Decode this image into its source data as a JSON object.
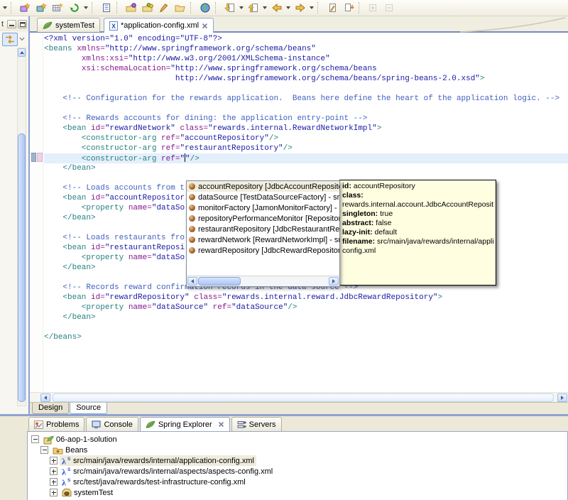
{
  "window": {
    "background": "#ece9d8"
  },
  "toolbar": {
    "items": [
      {
        "type": "caret",
        "name": "overflow-caret"
      },
      {
        "type": "sep"
      },
      {
        "type": "icon",
        "name": "new-spring-project"
      },
      {
        "type": "icon",
        "name": "new-wizard"
      },
      {
        "type": "icon",
        "name": "new-table"
      },
      {
        "type": "icon",
        "name": "refresh"
      },
      {
        "type": "caret",
        "name": "refresh-caret"
      },
      {
        "type": "sep"
      },
      {
        "type": "icon",
        "name": "open-editor"
      },
      {
        "type": "sep"
      },
      {
        "type": "icon",
        "name": "debug"
      },
      {
        "type": "icon",
        "name": "run"
      },
      {
        "type": "icon",
        "name": "external-tools"
      },
      {
        "type": "icon",
        "name": "open-folder"
      },
      {
        "type": "sep"
      },
      {
        "type": "icon",
        "name": "open-web-browser"
      },
      {
        "type": "sep"
      },
      {
        "type": "icon",
        "name": "import"
      },
      {
        "type": "caret",
        "name": "import-caret"
      },
      {
        "type": "icon",
        "name": "export"
      },
      {
        "type": "caret",
        "name": "export-caret"
      },
      {
        "type": "icon",
        "name": "back"
      },
      {
        "type": "caret",
        "name": "back-caret"
      },
      {
        "type": "icon",
        "name": "forward"
      },
      {
        "type": "caret",
        "name": "forward-caret"
      },
      {
        "type": "sep"
      },
      {
        "type": "icon",
        "name": "last-edit-location"
      },
      {
        "type": "icon",
        "name": "next-annotation"
      },
      {
        "type": "sep"
      },
      {
        "type": "icon",
        "name": "expand-all",
        "disabled": true
      },
      {
        "type": "icon",
        "name": "collapse-all",
        "disabled": true
      }
    ]
  },
  "left_panel": {
    "title_fragment": "t"
  },
  "editor": {
    "tabs": [
      {
        "label": "systemTest",
        "icon": "spring-leaf",
        "active": false,
        "closable": false
      },
      {
        "label": "*application-config.xml",
        "icon": "xml-file",
        "active": true,
        "closable": true
      }
    ],
    "page_tabs": [
      {
        "label": "Design",
        "active": false
      },
      {
        "label": "Source",
        "active": true
      }
    ],
    "current_line": 13,
    "code_lines": [
      [
        {
          "c": "pi",
          "t": "<?xml version=\"1.0\" encoding=\"UTF-8\"?>"
        }
      ],
      [
        {
          "c": "tag",
          "t": "<beans "
        },
        {
          "c": "attr",
          "t": "xmlns="
        },
        {
          "c": "val",
          "t": "\"http://www.springframework.org/schema/beans\""
        }
      ],
      [
        {
          "c": "txt",
          "t": "        "
        },
        {
          "c": "attr",
          "t": "xmlns:xsi="
        },
        {
          "c": "val",
          "t": "\"http://www.w3.org/2001/XMLSchema-instance\""
        }
      ],
      [
        {
          "c": "txt",
          "t": "        "
        },
        {
          "c": "attr",
          "t": "xsi:schemaLocation="
        },
        {
          "c": "val",
          "t": "\"http://www.springframework.org/schema/beans"
        }
      ],
      [
        {
          "c": "val",
          "t": "                            http://www.springframework.org/schema/beans/spring-beans-2.0.xsd\""
        },
        {
          "c": "tag",
          "t": ">"
        }
      ],
      [],
      [
        {
          "c": "com",
          "t": "    <!-- Configuration for the rewards application.  Beans here define the heart of the application logic. -->"
        }
      ],
      [],
      [
        {
          "c": "com",
          "t": "    <!-- Rewards accounts for dining: the application entry-point -->"
        }
      ],
      [
        {
          "c": "tag",
          "t": "    <bean "
        },
        {
          "c": "attr",
          "t": "id="
        },
        {
          "c": "val",
          "t": "\"rewardNetwork\""
        },
        {
          "c": "txt",
          "t": " "
        },
        {
          "c": "attr",
          "t": "class="
        },
        {
          "c": "val",
          "t": "\"rewards.internal.RewardNetworkImpl\""
        },
        {
          "c": "tag",
          "t": ">"
        }
      ],
      [
        {
          "c": "tag",
          "t": "        <constructor-arg "
        },
        {
          "c": "attr",
          "t": "ref="
        },
        {
          "c": "val",
          "t": "\"accountRepository\""
        },
        {
          "c": "tag",
          "t": "/>"
        }
      ],
      [
        {
          "c": "tag",
          "t": "        <constructor-arg "
        },
        {
          "c": "attr",
          "t": "ref="
        },
        {
          "c": "val",
          "t": "\"restaurantRepository\""
        },
        {
          "c": "tag",
          "t": "/>"
        }
      ],
      [
        {
          "c": "tag",
          "t": "        <constructor-arg "
        },
        {
          "c": "attr",
          "t": "ref="
        },
        {
          "c": "val",
          "t": "\""
        },
        {
          "c": "caret"
        },
        {
          "c": "val",
          "t": "\""
        },
        {
          "c": "tag",
          "t": "/>"
        }
      ],
      [
        {
          "c": "tag",
          "t": "    </bean>"
        }
      ],
      [],
      [
        {
          "c": "com",
          "t": "    <!-- Loads accounts from t"
        }
      ],
      [
        {
          "c": "tag",
          "t": "    <bean "
        },
        {
          "c": "attr",
          "t": "id="
        },
        {
          "c": "val",
          "t": "\"accountRepositor"
        }
      ],
      [
        {
          "c": "tag",
          "t": "        <property "
        },
        {
          "c": "attr",
          "t": "name="
        },
        {
          "c": "val",
          "t": "\"dataSo"
        }
      ],
      [
        {
          "c": "tag",
          "t": "    </bean>"
        }
      ],
      [],
      [
        {
          "c": "com",
          "t": "    <!-- Loads restaurants fro"
        }
      ],
      [
        {
          "c": "tag",
          "t": "    <bean "
        },
        {
          "c": "attr",
          "t": "id="
        },
        {
          "c": "val",
          "t": "\"restaurantReposi"
        }
      ],
      [
        {
          "c": "tag",
          "t": "        <property "
        },
        {
          "c": "attr",
          "t": "name="
        },
        {
          "c": "val",
          "t": "\"dataSo"
        }
      ],
      [
        {
          "c": "tag",
          "t": "    </bean>"
        }
      ],
      [],
      [
        {
          "c": "com",
          "t": "    <!-- Records reward confirmation records in the data source -->"
        }
      ],
      [
        {
          "c": "tag",
          "t": "    <bean "
        },
        {
          "c": "attr",
          "t": "id="
        },
        {
          "c": "val",
          "t": "\"rewardRepository\""
        },
        {
          "c": "txt",
          "t": " "
        },
        {
          "c": "attr",
          "t": "class="
        },
        {
          "c": "val",
          "t": "\"rewards.internal.reward.JdbcRewardRepository\""
        },
        {
          "c": "tag",
          "t": ">"
        }
      ],
      [
        {
          "c": "tag",
          "t": "        <property "
        },
        {
          "c": "attr",
          "t": "name="
        },
        {
          "c": "val",
          "t": "\"dataSource\""
        },
        {
          "c": "txt",
          "t": " "
        },
        {
          "c": "attr",
          "t": "ref="
        },
        {
          "c": "val",
          "t": "\"dataSource\""
        },
        {
          "c": "tag",
          "t": "/>"
        }
      ],
      [
        {
          "c": "tag",
          "t": "    </bean>"
        }
      ],
      [],
      [
        {
          "c": "tag",
          "t": "</beans>"
        }
      ]
    ]
  },
  "completion_popup": {
    "selected_index": 0,
    "items": [
      {
        "icon": "bean",
        "label": "accountRepository [JdbcAccountRepository] - src/main/ja"
      },
      {
        "icon": "bean",
        "label": "dataSource [TestDataSourceFactory] - src/test/ja"
      },
      {
        "icon": "bean",
        "label": "monitorFactory [JamonMonitorFactory] - src/main"
      },
      {
        "icon": "bean",
        "label": "repositoryPerformanceMonitor [RepositoryPerform"
      },
      {
        "icon": "bean",
        "label": "restaurantRepository [JdbcRestaurantRepository"
      },
      {
        "icon": "bean",
        "label": "rewardNetwork [RewardNetworkImpl] - src/main/j"
      },
      {
        "icon": "bean",
        "label": "rewardRepository [JdbcRewardRepository] - src/r"
      }
    ]
  },
  "bean_tooltip": {
    "lines": [
      [
        {
          "b": "id:"
        },
        {
          "t": " accountRepository"
        }
      ],
      [
        {
          "b": "class:"
        }
      ],
      [
        {
          "t": " rewards.internal.account.JdbcAccountRepository"
        }
      ],
      [
        {
          "b": "singleton:"
        },
        {
          "t": " true"
        }
      ],
      [
        {
          "b": "abstract:"
        },
        {
          "t": " false"
        }
      ],
      [
        {
          "b": "lazy-init:"
        },
        {
          "t": " default"
        }
      ],
      [
        {
          "b": "filename:"
        },
        {
          "t": " src/main/java/rewards/internal/application-"
        }
      ],
      [
        {
          "t": " config.xml"
        }
      ]
    ]
  },
  "bottom_panel": {
    "tabs": [
      {
        "label": "Problems",
        "icon": "problems",
        "active": false,
        "closable": false
      },
      {
        "label": "Console",
        "icon": "console",
        "active": false,
        "closable": false
      },
      {
        "label": "Spring Explorer",
        "icon": "spring-leaf",
        "active": true,
        "closable": true
      },
      {
        "label": "Servers",
        "icon": "servers",
        "active": false,
        "closable": false
      }
    ],
    "tree": [
      {
        "label": "06-aop-1-solution",
        "icon": "spring-project",
        "expander": "minus",
        "level": 0,
        "selected": false
      },
      {
        "label": "Beans",
        "icon": "beans-folder",
        "expander": "minus",
        "level": 1,
        "selected": false
      },
      {
        "label": "src/main/java/rewards/internal/application-config.xml",
        "icon": "spring-config",
        "expander": "plus",
        "level": 2,
        "selected": true
      },
      {
        "label": "src/main/java/rewards/internal/aspects/aspects-config.xml",
        "icon": "spring-config",
        "expander": "plus",
        "level": 2,
        "selected": false
      },
      {
        "label": "src/test/java/rewards/test-infrastructure-config.xml",
        "icon": "spring-config",
        "expander": "plus",
        "level": 2,
        "selected": false
      },
      {
        "label": "systemTest",
        "icon": "config-set",
        "expander": "plus",
        "level": 2,
        "selected": false
      }
    ]
  },
  "colors": {
    "tag": "#267f7f",
    "attribute": "#86188c",
    "value": "#1a1aa6",
    "comment": "#4060c0",
    "current_line": "#e3effb",
    "tooltip_bg": "#fffee1",
    "selection_bg": "#efecdc"
  }
}
